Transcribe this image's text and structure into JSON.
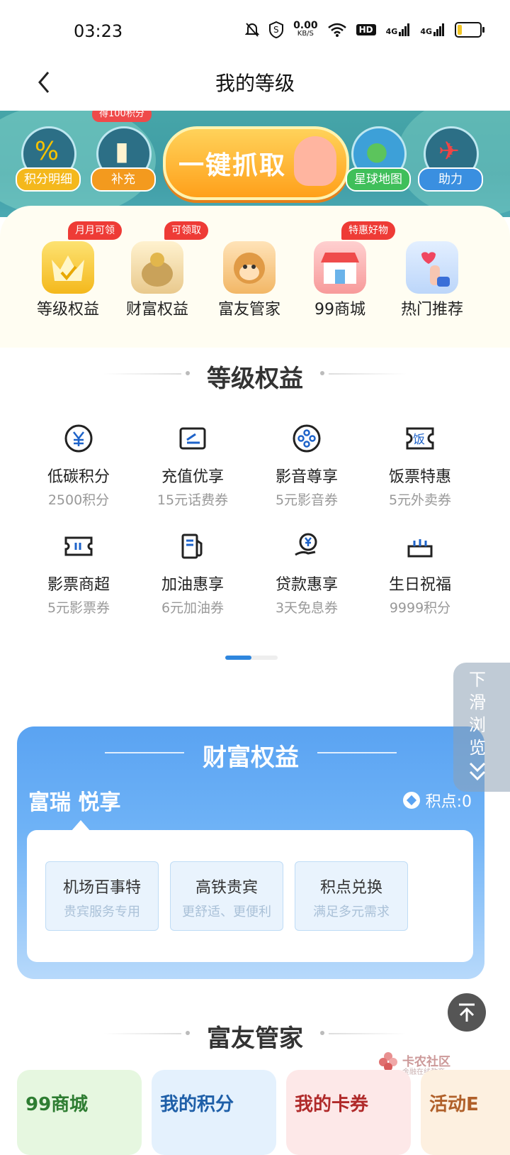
{
  "status_bar": {
    "time": "03:23",
    "net_speed_value": "0.00",
    "net_speed_unit": "KB/S",
    "hd_label": "HD",
    "signal1": "4G",
    "signal2": "4G",
    "battery_level": 0.2
  },
  "header": {
    "title": "我的等级"
  },
  "banner": {
    "top_tag": "得100积分",
    "items": [
      {
        "label": "积分明细",
        "icon": "percent-icon"
      },
      {
        "label": "补充",
        "icon": "cup-icon"
      },
      {
        "label": "星球地图",
        "icon": "planet-icon"
      },
      {
        "label": "助力",
        "icon": "rocket-icon"
      }
    ],
    "grab_label": "一键抓取"
  },
  "quick_access": [
    {
      "label": "等级权益",
      "badge": "月月可领",
      "color": "#f7c52e"
    },
    {
      "label": "财富权益",
      "badge": "可领取",
      "color": "#f0d9a8"
    },
    {
      "label": "富友管家",
      "badge": "",
      "color": "#f6d19c"
    },
    {
      "label": "99商城",
      "badge": "特惠好物",
      "color": "#f7b0b0"
    },
    {
      "label": "热门推荐",
      "badge": "",
      "color": "#cfe3fb"
    }
  ],
  "level_benefits": {
    "title": "等级权益",
    "items": [
      {
        "name": "低碳积分",
        "sub": "2500积分",
        "icon": "yuan-circle-icon"
      },
      {
        "name": "充值优享",
        "sub": "15元话费券",
        "icon": "card-icon"
      },
      {
        "name": "影音尊享",
        "sub": "5元影音券",
        "icon": "film-reel-icon"
      },
      {
        "name": "饭票特惠",
        "sub": "5元外卖券",
        "icon": "meal-ticket-icon",
        "glyph": "饭"
      },
      {
        "name": "影票商超",
        "sub": "5元影票券",
        "icon": "ticket-icon"
      },
      {
        "name": "加油惠享",
        "sub": "6元加油券",
        "icon": "gas-pump-icon"
      },
      {
        "name": "贷款惠享",
        "sub": "3天免息券",
        "icon": "loan-hand-icon"
      },
      {
        "name": "生日祝福",
        "sub": "9999积分",
        "icon": "cake-icon"
      }
    ],
    "page_index": 1,
    "page_count": 2
  },
  "side_tab": {
    "label": "下滑浏览"
  },
  "wealth": {
    "title": "财富权益",
    "tab_label": "富瑞 悦享",
    "points_label": "积点:0",
    "services": [
      {
        "name": "机场百事特",
        "sub": "贵宾服务专用"
      },
      {
        "name": "高铁贵宾",
        "sub": "更舒适、更便利"
      },
      {
        "name": "积点兑换",
        "sub": "满足多元需求"
      }
    ]
  },
  "butler": {
    "title": "富友管家",
    "cards": [
      {
        "label": "99商城",
        "bg": "#e6f7e0",
        "fg": "#2e7d32"
      },
      {
        "label": "我的积分",
        "bg": "#e4f1fd",
        "fg": "#1e5fa8"
      },
      {
        "label": "我的卡券",
        "bg": "#fde8e8",
        "fg": "#b02a2a"
      },
      {
        "label": "活动E",
        "bg": "#fdf0e0",
        "fg": "#b0602a"
      }
    ]
  },
  "watermark": {
    "name": "卡农社区",
    "tagline": "金融在线教育"
  }
}
